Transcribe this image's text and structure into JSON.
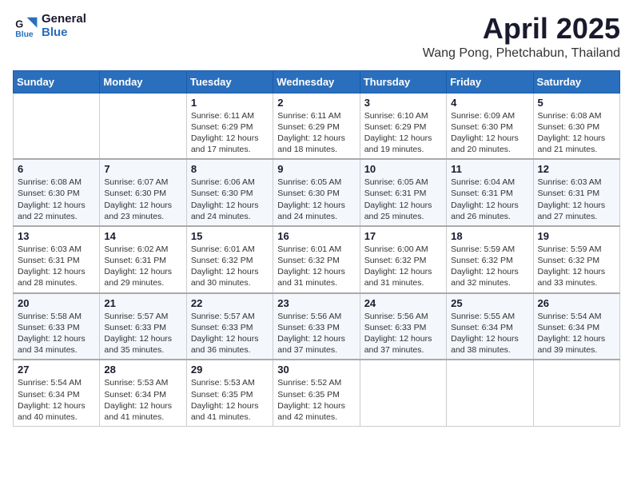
{
  "header": {
    "logo_general": "General",
    "logo_blue": "Blue",
    "title": "April 2025",
    "subtitle": "Wang Pong, Phetchabun, Thailand"
  },
  "weekdays": [
    "Sunday",
    "Monday",
    "Tuesday",
    "Wednesday",
    "Thursday",
    "Friday",
    "Saturday"
  ],
  "weeks": [
    [
      {
        "day": "",
        "info": ""
      },
      {
        "day": "",
        "info": ""
      },
      {
        "day": "1",
        "info": "Sunrise: 6:11 AM\nSunset: 6:29 PM\nDaylight: 12 hours and 17 minutes."
      },
      {
        "day": "2",
        "info": "Sunrise: 6:11 AM\nSunset: 6:29 PM\nDaylight: 12 hours and 18 minutes."
      },
      {
        "day": "3",
        "info": "Sunrise: 6:10 AM\nSunset: 6:29 PM\nDaylight: 12 hours and 19 minutes."
      },
      {
        "day": "4",
        "info": "Sunrise: 6:09 AM\nSunset: 6:30 PM\nDaylight: 12 hours and 20 minutes."
      },
      {
        "day": "5",
        "info": "Sunrise: 6:08 AM\nSunset: 6:30 PM\nDaylight: 12 hours and 21 minutes."
      }
    ],
    [
      {
        "day": "6",
        "info": "Sunrise: 6:08 AM\nSunset: 6:30 PM\nDaylight: 12 hours and 22 minutes."
      },
      {
        "day": "7",
        "info": "Sunrise: 6:07 AM\nSunset: 6:30 PM\nDaylight: 12 hours and 23 minutes."
      },
      {
        "day": "8",
        "info": "Sunrise: 6:06 AM\nSunset: 6:30 PM\nDaylight: 12 hours and 24 minutes."
      },
      {
        "day": "9",
        "info": "Sunrise: 6:05 AM\nSunset: 6:30 PM\nDaylight: 12 hours and 24 minutes."
      },
      {
        "day": "10",
        "info": "Sunrise: 6:05 AM\nSunset: 6:31 PM\nDaylight: 12 hours and 25 minutes."
      },
      {
        "day": "11",
        "info": "Sunrise: 6:04 AM\nSunset: 6:31 PM\nDaylight: 12 hours and 26 minutes."
      },
      {
        "day": "12",
        "info": "Sunrise: 6:03 AM\nSunset: 6:31 PM\nDaylight: 12 hours and 27 minutes."
      }
    ],
    [
      {
        "day": "13",
        "info": "Sunrise: 6:03 AM\nSunset: 6:31 PM\nDaylight: 12 hours and 28 minutes."
      },
      {
        "day": "14",
        "info": "Sunrise: 6:02 AM\nSunset: 6:31 PM\nDaylight: 12 hours and 29 minutes."
      },
      {
        "day": "15",
        "info": "Sunrise: 6:01 AM\nSunset: 6:32 PM\nDaylight: 12 hours and 30 minutes."
      },
      {
        "day": "16",
        "info": "Sunrise: 6:01 AM\nSunset: 6:32 PM\nDaylight: 12 hours and 31 minutes."
      },
      {
        "day": "17",
        "info": "Sunrise: 6:00 AM\nSunset: 6:32 PM\nDaylight: 12 hours and 31 minutes."
      },
      {
        "day": "18",
        "info": "Sunrise: 5:59 AM\nSunset: 6:32 PM\nDaylight: 12 hours and 32 minutes."
      },
      {
        "day": "19",
        "info": "Sunrise: 5:59 AM\nSunset: 6:32 PM\nDaylight: 12 hours and 33 minutes."
      }
    ],
    [
      {
        "day": "20",
        "info": "Sunrise: 5:58 AM\nSunset: 6:33 PM\nDaylight: 12 hours and 34 minutes."
      },
      {
        "day": "21",
        "info": "Sunrise: 5:57 AM\nSunset: 6:33 PM\nDaylight: 12 hours and 35 minutes."
      },
      {
        "day": "22",
        "info": "Sunrise: 5:57 AM\nSunset: 6:33 PM\nDaylight: 12 hours and 36 minutes."
      },
      {
        "day": "23",
        "info": "Sunrise: 5:56 AM\nSunset: 6:33 PM\nDaylight: 12 hours and 37 minutes."
      },
      {
        "day": "24",
        "info": "Sunrise: 5:56 AM\nSunset: 6:33 PM\nDaylight: 12 hours and 37 minutes."
      },
      {
        "day": "25",
        "info": "Sunrise: 5:55 AM\nSunset: 6:34 PM\nDaylight: 12 hours and 38 minutes."
      },
      {
        "day": "26",
        "info": "Sunrise: 5:54 AM\nSunset: 6:34 PM\nDaylight: 12 hours and 39 minutes."
      }
    ],
    [
      {
        "day": "27",
        "info": "Sunrise: 5:54 AM\nSunset: 6:34 PM\nDaylight: 12 hours and 40 minutes."
      },
      {
        "day": "28",
        "info": "Sunrise: 5:53 AM\nSunset: 6:34 PM\nDaylight: 12 hours and 41 minutes."
      },
      {
        "day": "29",
        "info": "Sunrise: 5:53 AM\nSunset: 6:35 PM\nDaylight: 12 hours and 41 minutes."
      },
      {
        "day": "30",
        "info": "Sunrise: 5:52 AM\nSunset: 6:35 PM\nDaylight: 12 hours and 42 minutes."
      },
      {
        "day": "",
        "info": ""
      },
      {
        "day": "",
        "info": ""
      },
      {
        "day": "",
        "info": ""
      }
    ]
  ]
}
